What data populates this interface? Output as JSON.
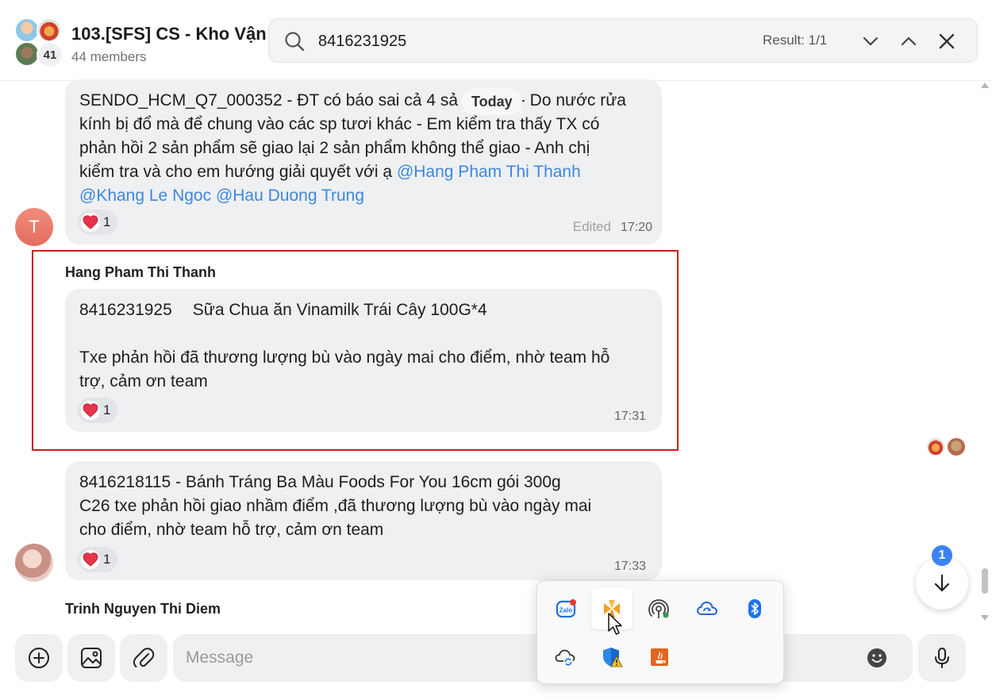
{
  "header": {
    "group_title": "103.[SFS] CS - Kho Vận",
    "members": "44 members",
    "avatar_extra_count": "41"
  },
  "search": {
    "query": "8416231925",
    "result": "Result: 1/1"
  },
  "chat": {
    "today_label": "Today",
    "message1": {
      "avatar_letter": "T",
      "line1_a": "SENDO_HCM_Q7_000352 - ĐT có báo sai cả 4 sả",
      "line1_b": " - Do nước rửa",
      "line2": "kính bị đổ mà để chung vào các sp tươi khác - Em kiểm tra thấy TX có",
      "line3": "phản hồi 2 sản phẩm sẽ giao lại 2 sản phẩm không thể giao - Anh chị",
      "line4_text": "kiểm tra và cho em hướng giải quyết với ạ ",
      "mention1": "@Hang Pham Thi Thanh",
      "mention2": "@Khang Le Ngoc",
      "mention3": "@Hau Duong Trung",
      "reaction_count": "1",
      "edited": "Edited",
      "time": "17:20"
    },
    "message2": {
      "sender": "Hang Pham Thi Thanh",
      "line1_code": "8416231925",
      "line1_product": "Sữa Chua ăn Vinamilk Trái Cây 100G*4",
      "line2": "Txe phản hồi đã thương lượng bù vào ngày mai cho điểm, nhờ team hỗ",
      "line3": "trợ, cảm ơn team",
      "reaction_count": "1",
      "time": "17:31"
    },
    "message3": {
      "line1": "8416218115 - Bánh Tráng Ba Màu Foods For You 16cm gói 300g",
      "line2": "C26 txe phản hồi giao nhầm điểm ,đã thương lượng bù vào ngày mai",
      "line3": "cho điểm, nhờ team hỗ trợ, cảm ơn team",
      "reaction_count": "1",
      "time": "17:33"
    },
    "next_sender": "Trinh Nguyen Thi Diem",
    "unread_count": "1"
  },
  "composer": {
    "placeholder": "Message"
  },
  "tray": {
    "icons": [
      "zalo-icon",
      "app-orange-icon",
      "wireless-icon",
      "cloud-sync-icon",
      "bluetooth-icon",
      "onedrive-icon",
      "security-warning-icon",
      "java-icon"
    ]
  },
  "colors": {
    "mention": "#3d87e0",
    "highlight_border": "#cc1e1e",
    "bubble": "#eef0f2",
    "badge": "#3b82f6"
  }
}
